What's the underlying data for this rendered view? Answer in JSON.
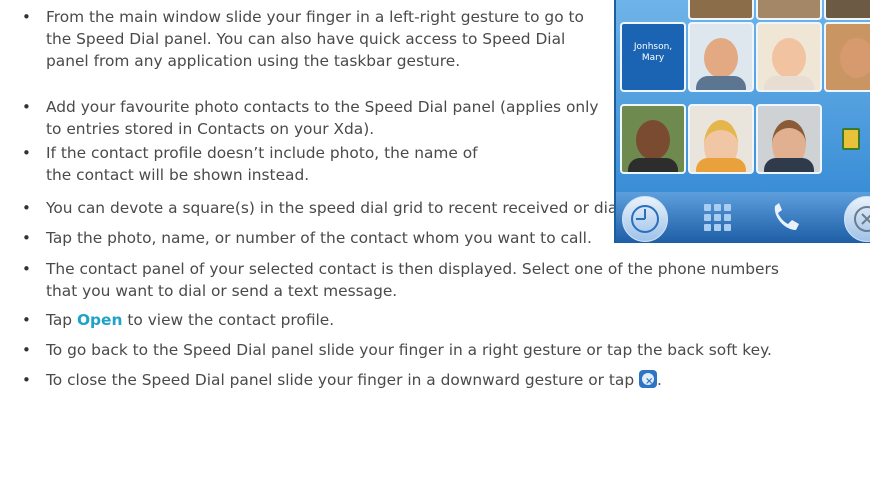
{
  "bullets": [
    "From the main window slide your finger in a left-right gesture to go to the Speed Dial panel. You can also have quick access to Speed Dial panel from any application using the taskbar gesture.",
    "Add your favourite photo contacts to the Speed Dial panel (applies only to entries stored in Contacts on your Xda).",
    "If the contact profile doesn’t include photo, the name of the contact will be shown instead.",
    "You can devote a square(s) in the speed dial grid to recent received or dialled calls.",
    "Tap the photo, name, or number of the contact whom you want to call.",
    "The contact panel of your selected contact is then displayed. Select one of the phone numbers that you want to dial or send a text message."
  ],
  "open_bullet": {
    "prefix": "Tap ",
    "keyword": "Open",
    "suffix": " to view the contact profile."
  },
  "back_bullet": "To go back to the Speed Dial panel slide your finger in a right gesture or tap the back soft key.",
  "close_bullet": {
    "text": "To close the Speed Dial panel slide your finger in a downward gesture or tap ",
    "end": "."
  },
  "screenshot": {
    "contact_name": "Jonhson, Mary"
  },
  "colors": {
    "keyword": "#1ea3c8",
    "text": "#4a4a4a",
    "panel": "#2c84d1"
  }
}
